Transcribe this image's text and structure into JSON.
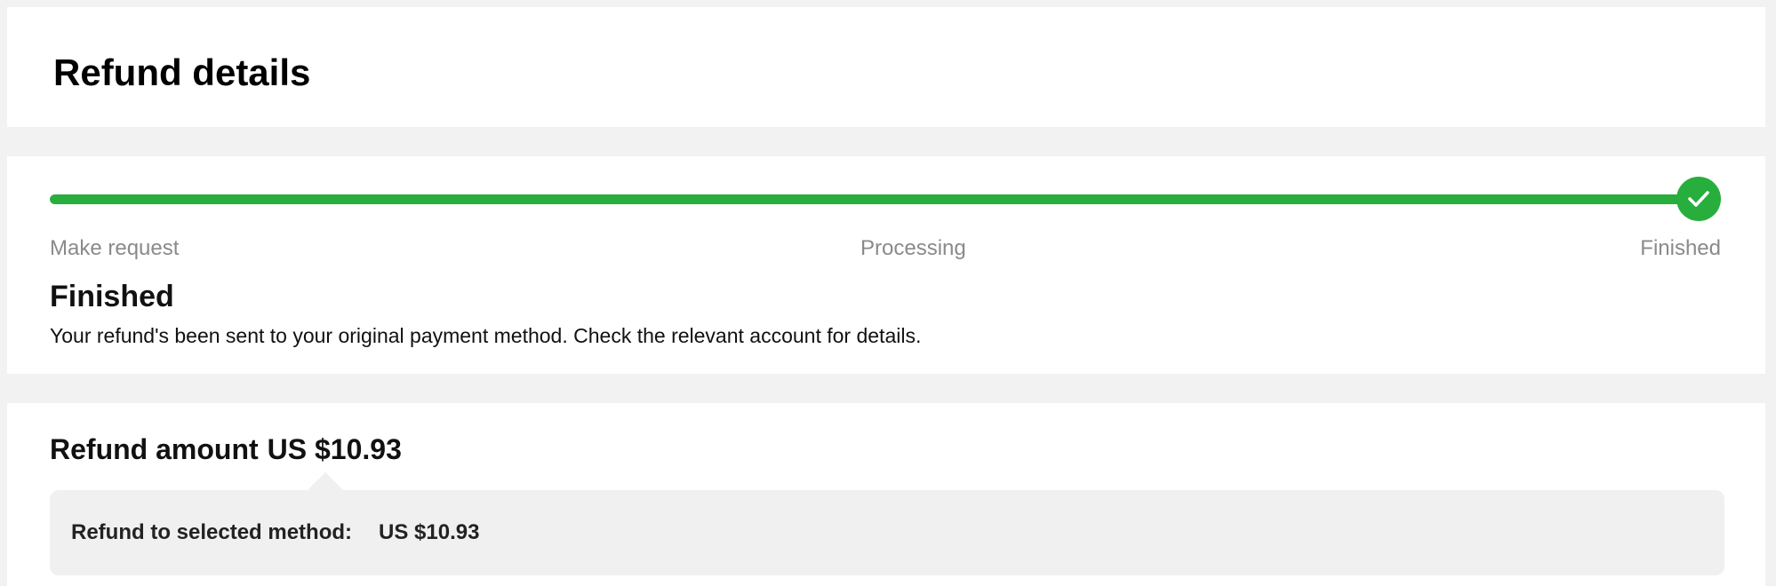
{
  "header": {
    "title": "Refund details"
  },
  "progress": {
    "fraction_complete": 1.0,
    "accent_color": "#27ae3d",
    "completed_icon": "check-icon",
    "steps": [
      {
        "label": "Make request"
      },
      {
        "label": "Processing"
      },
      {
        "label": "Finished"
      }
    ],
    "status_title": "Finished",
    "status_description": "Your refund's been sent to your original payment method. Check the relevant account for details."
  },
  "amount": {
    "label": "Refund amount",
    "value": "US $10.93",
    "method_label": "Refund to selected method:",
    "method_value": "US $10.93"
  }
}
